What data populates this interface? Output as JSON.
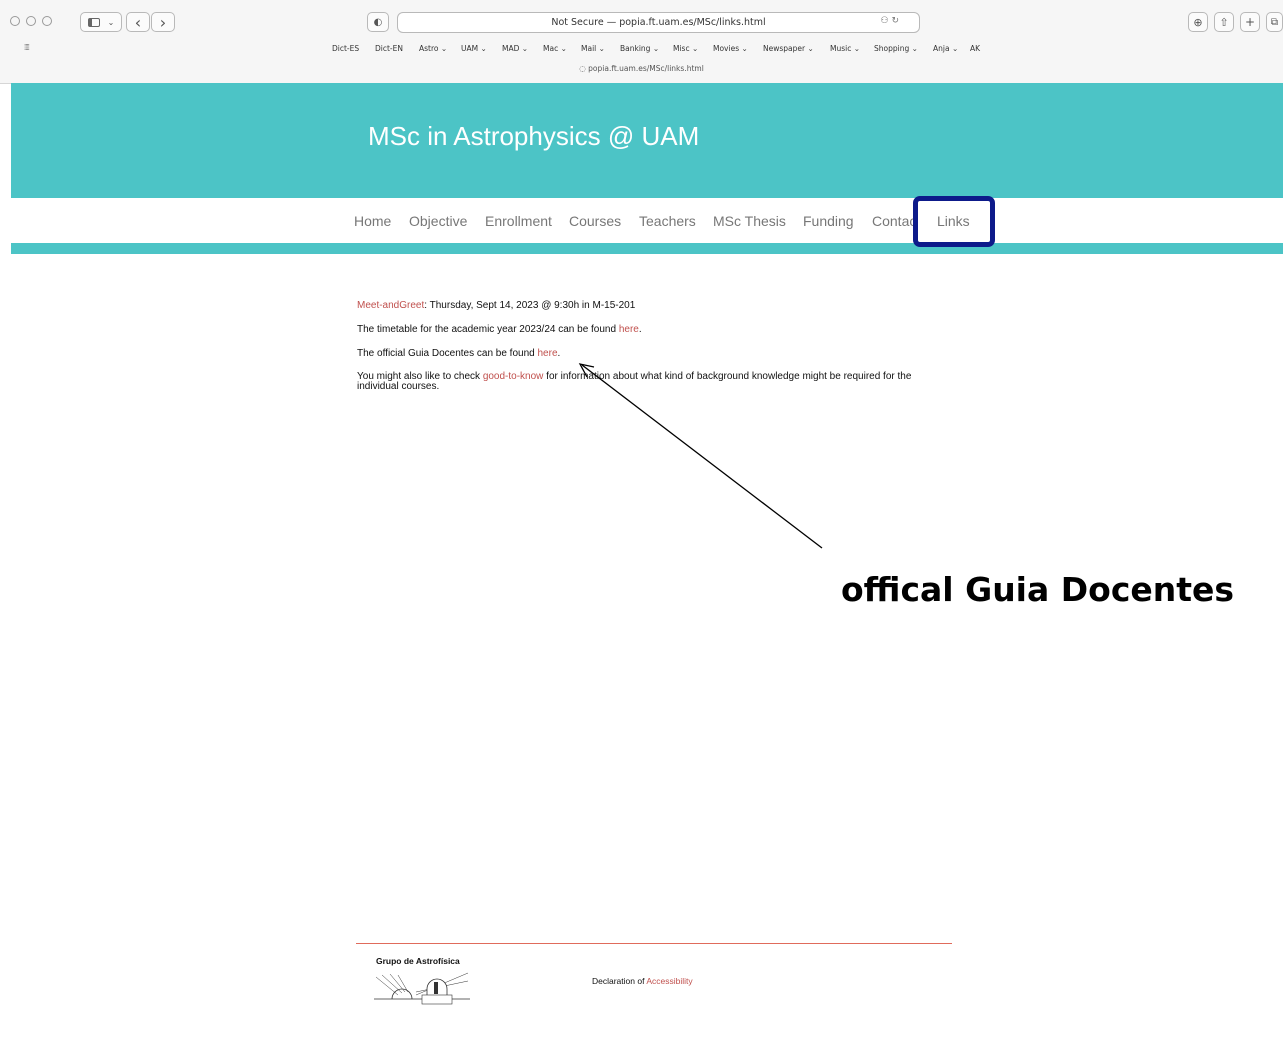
{
  "browser": {
    "address": "Not Secure — popia.ft.uam.es/MSc/links.html",
    "tab_title": "popia.ft.uam.es/MSc/links.html",
    "bookmarks": [
      "Dict-ES",
      "Dict-EN",
      "Astro ⌄",
      "UAM ⌄",
      "MAD ⌄",
      "Mac ⌄",
      "Mail ⌄",
      "Banking ⌄",
      "Misc ⌄",
      "Movies ⌄",
      "Newspaper ⌄",
      "Music ⌄",
      "Shopping ⌄",
      "Anja ⌄",
      "AK"
    ]
  },
  "site": {
    "title": "MSc in Astrophysics @ UAM",
    "nav": [
      "Home",
      "Objective",
      "Enrollment",
      "Courses",
      "Teachers",
      "MSc Thesis",
      "Funding",
      "Contac",
      "Links"
    ]
  },
  "content": {
    "p1_link": "Meet-andGreet",
    "p1_text": ": Thursday, Sept 14, 2023 @ 9:30h in M-15-201",
    "p2_text": "The timetable for the academic year 2023/24 can be found ",
    "p2_link": "here",
    "p2_end": ".",
    "p3_text": "The official Guia Docentes can be found ",
    "p3_link": "here",
    "p3_end": ".",
    "p4_text": "You might also like to check ",
    "p4_link": "good-to-know",
    "p4_rest": " for information about what kind of background knowledge might be required for the individual courses."
  },
  "annotation": {
    "label": "offical Guia Docentes",
    "highlight_color": "#0d1a8a"
  },
  "footer": {
    "logo_text": "Grupo de Astrofísica",
    "acc_text": "Declaration of ",
    "acc_link": "Accessibility"
  },
  "colors": {
    "teal": "#4cc4c6",
    "link": "#c0504d"
  }
}
